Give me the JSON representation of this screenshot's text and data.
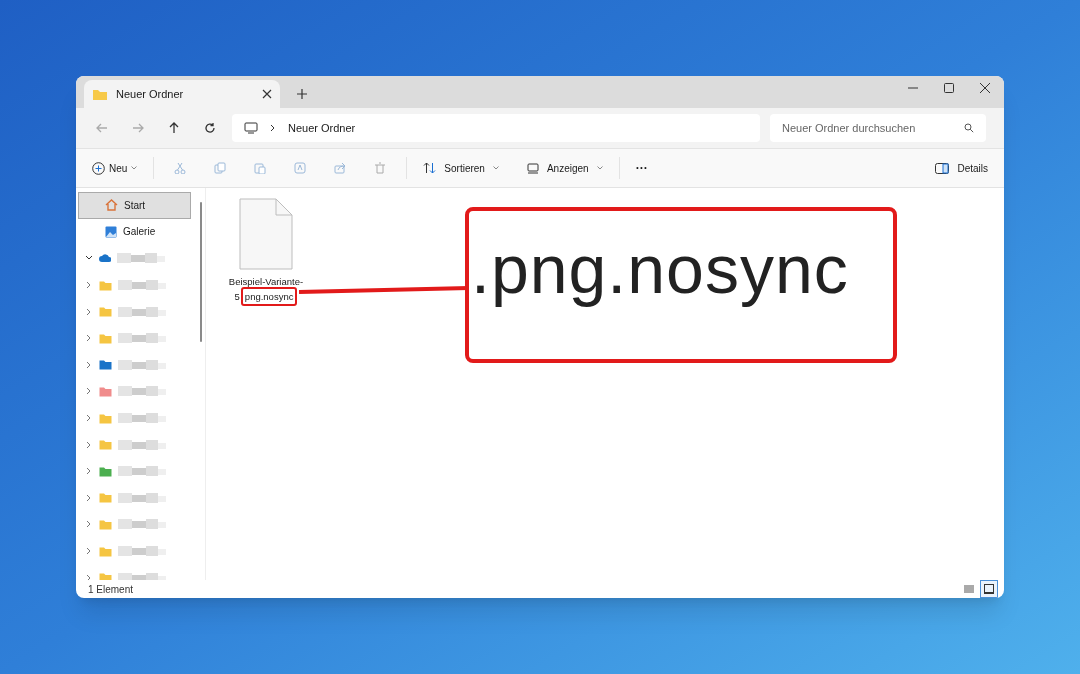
{
  "tabs": [
    {
      "label": "Neuer Ordner",
      "selected": true
    }
  ],
  "address_bar": {
    "path": "Neuer Ordner"
  },
  "search": {
    "placeholder": "Neuer Ordner durchsuchen"
  },
  "toolbar": {
    "new": "Neu",
    "sort": "Sortieren",
    "view": "Anzeigen",
    "more": "···",
    "details": "Details"
  },
  "sidebar": {
    "items": [
      {
        "kind": "home",
        "label": "Start",
        "selected": true
      },
      {
        "kind": "gallery",
        "label": "Galerie",
        "selected": false
      },
      {
        "kind": "cloud",
        "expanded": true,
        "selected": false
      },
      {
        "kind": "folder",
        "color": "#f5c542",
        "selected": false
      },
      {
        "kind": "folder",
        "color": "#f5c542",
        "selected": false
      },
      {
        "kind": "folder",
        "color": "#f5c542",
        "selected": false
      },
      {
        "kind": "folder",
        "color": "#1a73c8",
        "selected": false
      },
      {
        "kind": "folder",
        "color": "#f08c8c",
        "selected": false
      },
      {
        "kind": "folder",
        "color": "#f5c542",
        "selected": false
      },
      {
        "kind": "folder",
        "color": "#f5c542",
        "selected": false
      },
      {
        "kind": "folder",
        "color": "#4caf50",
        "selected": false
      },
      {
        "kind": "folder",
        "color": "#f5c542",
        "selected": false
      },
      {
        "kind": "folder",
        "color": "#f5c542",
        "selected": false
      },
      {
        "kind": "folder",
        "color": "#f5c542",
        "selected": false
      },
      {
        "kind": "folder",
        "color": "#f5c542",
        "selected": false
      }
    ]
  },
  "files": [
    {
      "name_line_1": "Beispiel-Variante-",
      "name_line_2": "5",
      "highlighted": "png.nosync"
    }
  ],
  "callout": {
    "text": ".png.nosync"
  },
  "status_bar": {
    "count": "1 Element"
  },
  "view_buttons": [
    {
      "kind": "details",
      "selected": false
    },
    {
      "kind": "tiles",
      "selected": true
    }
  ]
}
